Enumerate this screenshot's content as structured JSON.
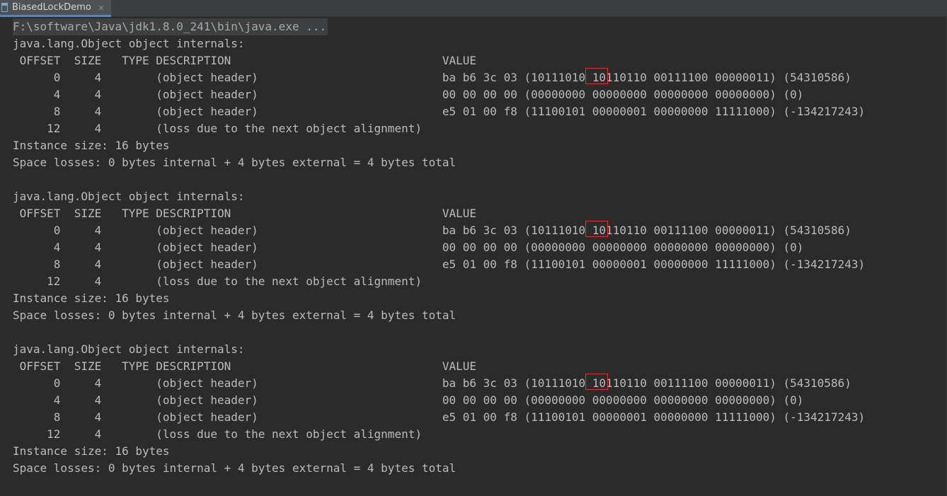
{
  "tab": {
    "label": "BiasedLockDemo",
    "close_glyph": "×"
  },
  "console": {
    "command": "F:\\software\\Java\\jdk1.8.0_241\\bin\\java.exe ...",
    "blocks": [
      {
        "title": "java.lang.Object object internals:",
        "header": " OFFSET  SIZE   TYPE DESCRIPTION                               VALUE",
        "rows": [
          "      0     4        (object header)                           ba b6 3c 03 (10111010 10110110 00111100 00000011) (54310586)",
          "      4     4        (object header)                           00 00 00 00 (00000000 00000000 00000000 00000000) (0)",
          "      8     4        (object header)                           e5 01 00 f8 (11100101 00000001 00000000 11111000) (-134217243)",
          "     12     4        (loss due to the next object alignment)"
        ],
        "instance_size": "Instance size: 16 bytes",
        "space_losses": "Space losses: 0 bytes internal + 4 bytes external = 4 bytes total"
      },
      {
        "title": "java.lang.Object object internals:",
        "header": " OFFSET  SIZE   TYPE DESCRIPTION                               VALUE",
        "rows": [
          "      0     4        (object header)                           ba b6 3c 03 (10111010 10110110 00111100 00000011) (54310586)",
          "      4     4        (object header)                           00 00 00 00 (00000000 00000000 00000000 00000000) (0)",
          "      8     4        (object header)                           e5 01 00 f8 (11100101 00000001 00000000 11111000) (-134217243)",
          "     12     4        (loss due to the next object alignment)"
        ],
        "instance_size": "Instance size: 16 bytes",
        "space_losses": "Space losses: 0 bytes internal + 4 bytes external = 4 bytes total"
      },
      {
        "title": "java.lang.Object object internals:",
        "header": " OFFSET  SIZE   TYPE DESCRIPTION                               VALUE",
        "rows": [
          "      0     4        (object header)                           ba b6 3c 03 (10111010 10110110 00111100 00000011) (54310586)",
          "      4     4        (object header)                           00 00 00 00 (00000000 00000000 00000000 00000000) (0)",
          "      8     4        (object header)                           e5 01 00 f8 (11100101 00000001 00000000 11111000) (-134217243)",
          "     12     4        (loss due to the next object alignment)"
        ],
        "instance_size": "Instance size: 16 bytes",
        "space_losses": "Space losses: 0 bytes internal + 4 bytes external = 4 bytes total"
      }
    ]
  },
  "colors": {
    "background": "#2b2b2b",
    "text": "#bbbbbb",
    "highlight_box": "#e0332f",
    "tab_underline": "#4a88c7"
  }
}
